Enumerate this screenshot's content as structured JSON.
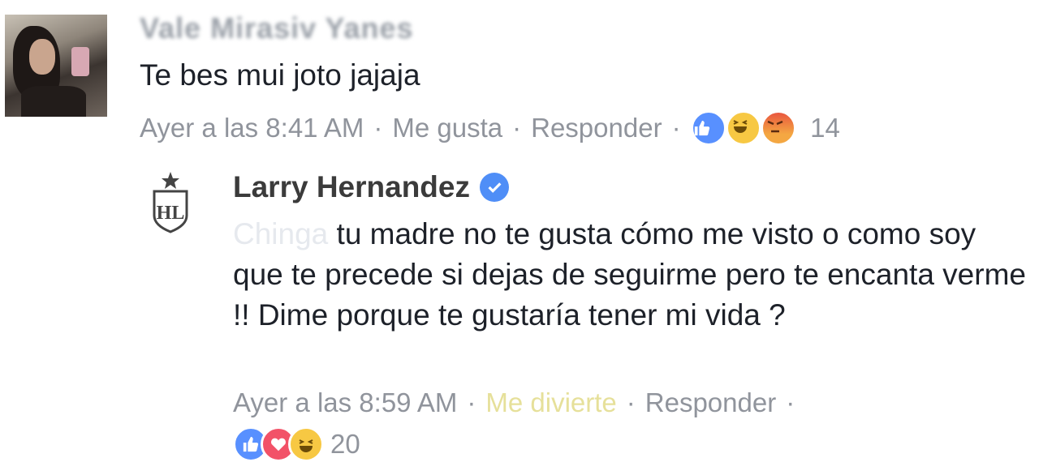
{
  "comment": {
    "author": "Vale Mirasiv Yanes",
    "text": "Te bes mui joto jajaja",
    "time": "Ayer a las 8:41 AM",
    "like_label": "Me gusta",
    "reply_label": "Responder",
    "separator": "·",
    "reaction_count": "14",
    "reactions": [
      "like-icon",
      "haha-icon",
      "angry-icon"
    ]
  },
  "reply": {
    "author": "Larry Hernandez",
    "verified": true,
    "text_censored": "Chinga",
    "text": " tu madre no te gusta cómo me visto o como soy que te precede si dejas de seguirme pero te encanta verme !! Dime porque te gustaría tener mi vida ?",
    "time": "Ayer a las 8:59 AM",
    "reaction_label": "Me divierte",
    "reply_label": "Responder",
    "separator": "·",
    "reaction_count": "20",
    "reactions": [
      "like-icon",
      "love-icon",
      "haha-icon"
    ],
    "logo_text": "HL"
  },
  "colors": {
    "meta_gray": "#90949c",
    "like_blue": "#5890ff",
    "verified_blue": "#4f8ef7",
    "love_red": "#f25268",
    "haha_yellow": "#f7c843"
  }
}
